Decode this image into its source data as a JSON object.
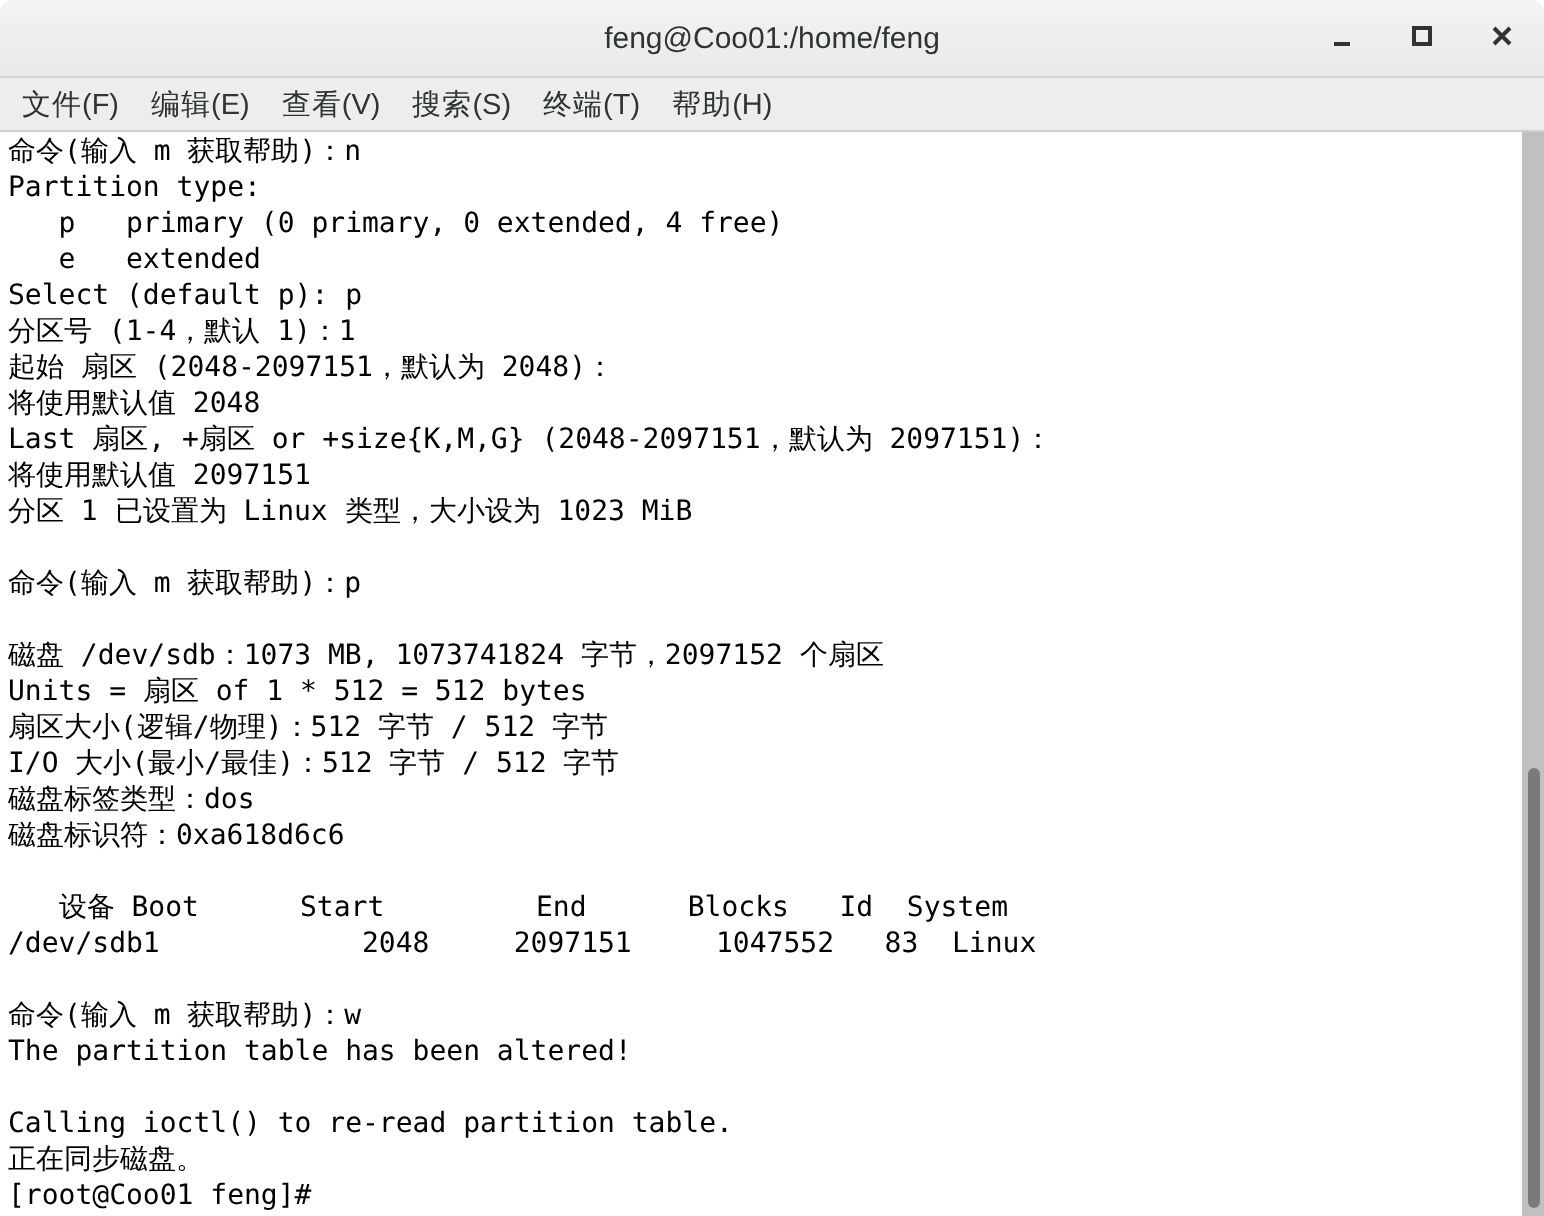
{
  "window": {
    "title": "feng@Coo01:/home/feng"
  },
  "menu": [
    "文件(F)",
    "编辑(E)",
    "查看(V)",
    "搜索(S)",
    "终端(T)",
    "帮助(H)"
  ],
  "terminal": {
    "blocks": [
      [
        "命令(输入 m 获取帮助)：n",
        "Partition type:",
        "   p   primary (0 primary, 0 extended, 4 free)",
        "   e   extended",
        "Select (default p): p",
        "分区号 (1-4，默认 1)：1",
        "起始 扇区 (2048-2097151，默认为 2048)：",
        "将使用默认值 2048",
        "Last 扇区, +扇区 or +size{K,M,G} (2048-2097151，默认为 2097151)：",
        "将使用默认值 2097151",
        "分区 1 已设置为 Linux 类型，大小设为 1023 MiB"
      ],
      [
        "命令(输入 m 获取帮助)：p"
      ],
      [
        "磁盘 /dev/sdb：1073 MB, 1073741824 字节，2097152 个扇区",
        "Units = 扇区 of 1 * 512 = 512 bytes",
        "扇区大小(逻辑/物理)：512 字节 / 512 字节",
        "I/O 大小(最小/最佳)：512 字节 / 512 字节",
        "磁盘标签类型：dos",
        "磁盘标识符：0xa618d6c6"
      ],
      [
        "   设备 Boot      Start         End      Blocks   Id  System",
        "/dev/sdb1            2048     2097151     1047552   83  Linux"
      ],
      [
        "命令(输入 m 获取帮助)：w",
        "The partition table has been altered!"
      ],
      [
        "Calling ioctl() to re-read partition table.",
        "正在同步磁盘。",
        "[root@Coo01 feng]# "
      ]
    ]
  }
}
